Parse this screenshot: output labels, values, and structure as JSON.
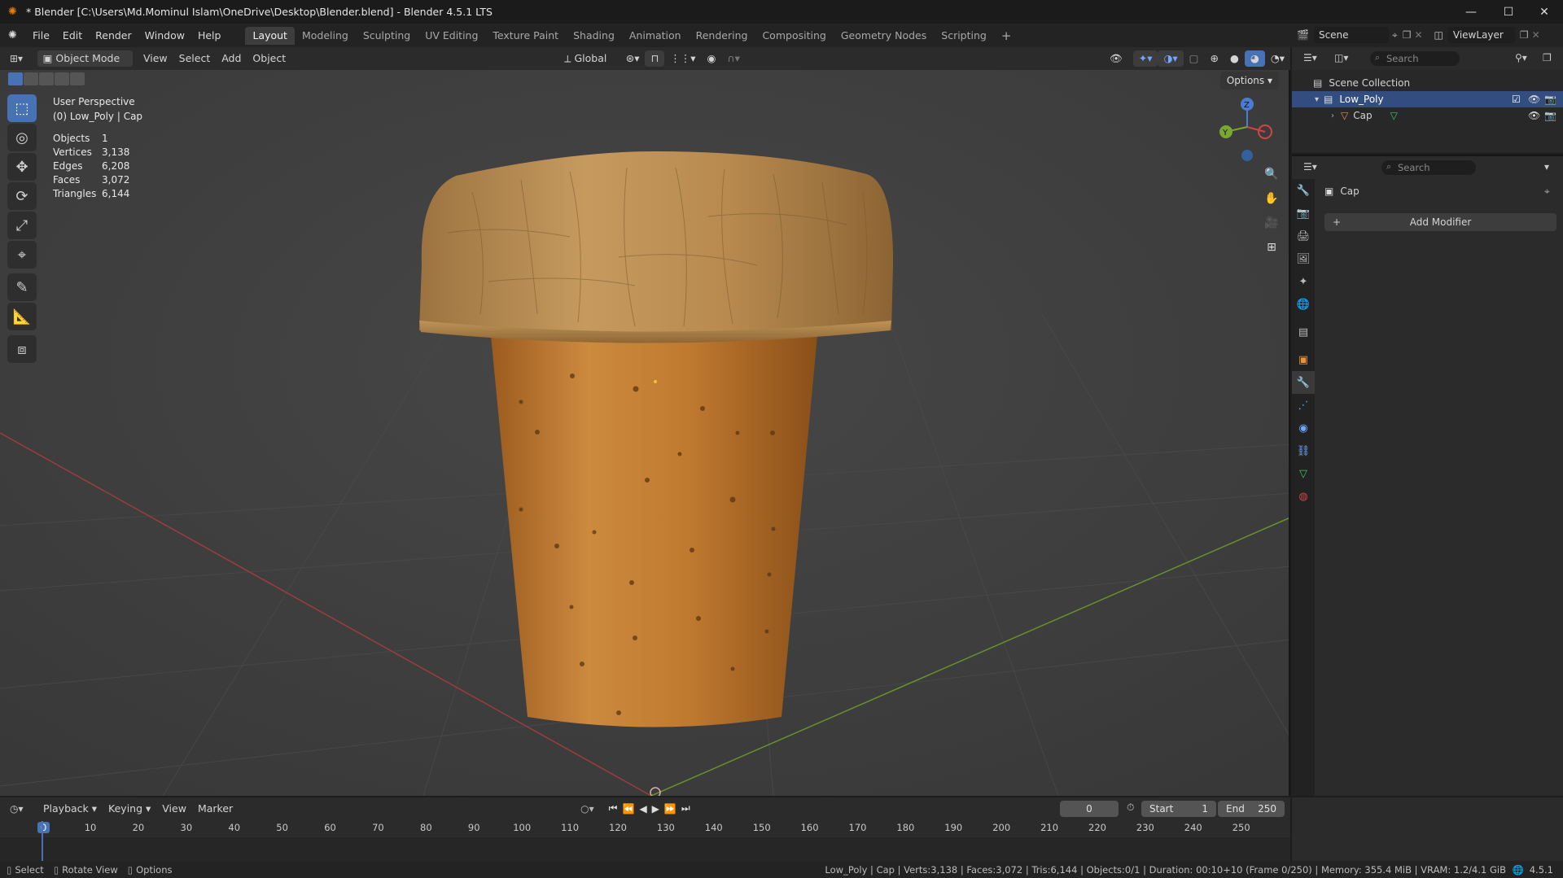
{
  "window": {
    "title": "* Blender [C:\\Users\\Md.Mominul Islam\\OneDrive\\Desktop\\Blender.blend] - Blender 4.5.1 LTS"
  },
  "menus": [
    "File",
    "Edit",
    "Render",
    "Window",
    "Help"
  ],
  "workspaces": [
    "Layout",
    "Modeling",
    "Sculpting",
    "UV Editing",
    "Texture Paint",
    "Shading",
    "Animation",
    "Rendering",
    "Compositing",
    "Geometry Nodes",
    "Scripting"
  ],
  "active_workspace": "Layout",
  "scene": {
    "name": "Scene",
    "view_layer": "ViewLayer"
  },
  "viewport_header": {
    "mode": "Object Mode",
    "menus": [
      "View",
      "Select",
      "Add",
      "Object"
    ],
    "transform_orientation": "Global",
    "options_label": "Options"
  },
  "viewport_overlay": {
    "view_name": "User Perspective",
    "collection_object": "(0) Low_Poly | Cap",
    "stats": [
      {
        "label": "Objects",
        "value": "1"
      },
      {
        "label": "Vertices",
        "value": "3,138"
      },
      {
        "label": "Edges",
        "value": "6,208"
      },
      {
        "label": "Faces",
        "value": "3,072"
      },
      {
        "label": "Triangles",
        "value": "6,144"
      }
    ]
  },
  "gizmo": {
    "z": "Z",
    "y": "Y"
  },
  "outliner": {
    "search_placeholder": "Search",
    "root": "Scene Collection",
    "collection": "Low_Poly",
    "object": "Cap"
  },
  "properties": {
    "search_placeholder": "Search",
    "object_name": "Cap",
    "add_modifier_label": "Add Modifier"
  },
  "timeline": {
    "menus": [
      "Playback",
      "Keying",
      "View",
      "Marker"
    ],
    "current_frame": "0",
    "start_label": "Start",
    "start_value": "1",
    "end_label": "End",
    "end_value": "250",
    "ticks": [
      "0",
      "10",
      "20",
      "30",
      "40",
      "50",
      "60",
      "70",
      "80",
      "90",
      "100",
      "110",
      "120",
      "130",
      "140",
      "150",
      "160",
      "170",
      "180",
      "190",
      "200",
      "210",
      "220",
      "230",
      "240",
      "250"
    ]
  },
  "statusbar": {
    "select": "Select",
    "rotate": "Rotate View",
    "options": "Options",
    "info": "Low_Poly | Cap | Verts:3,138 | Faces:3,072 | Tris:6,144 | Objects:0/1 | Duration: 00:10+10 (Frame 0/250) | Memory: 355.4 MiB | VRAM: 1.2/4.1 GiB",
    "version": "4.5.1"
  },
  "colors": {
    "accent": "#4772b3",
    "cork_top": "#b8884e",
    "cork_body": "#c5782c"
  }
}
